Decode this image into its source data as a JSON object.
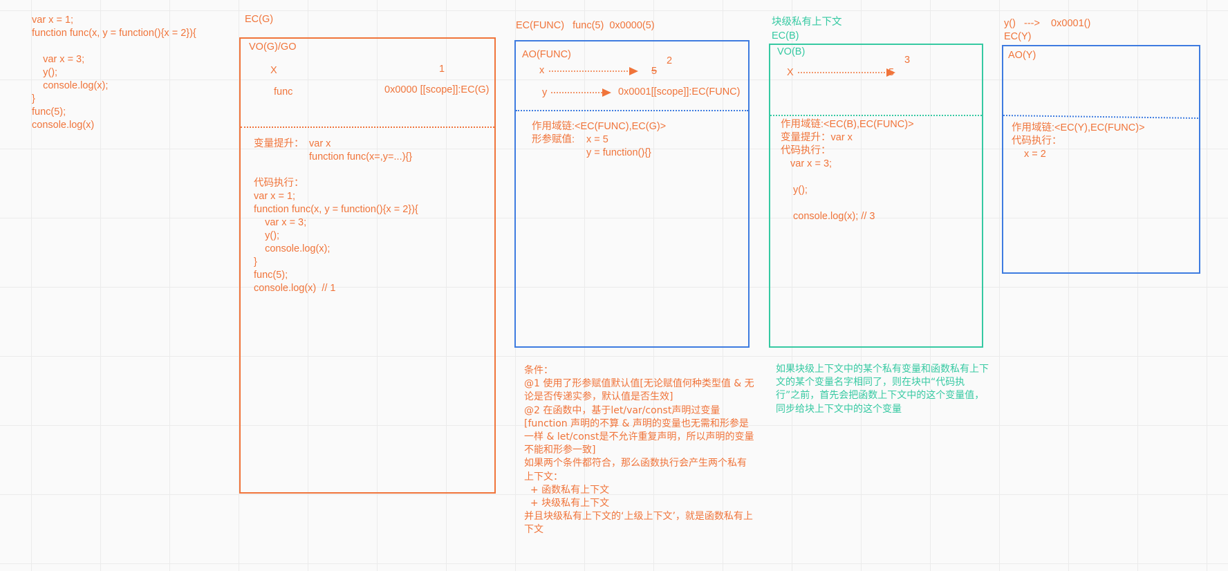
{
  "colors": {
    "orange": "#f0743a",
    "blue": "#3d7be0",
    "teal": "#36c9a2",
    "grid": "#ebebeb",
    "background": "#fafafa"
  },
  "source_code": [
    "var x = 1;",
    "function func(x, y = function(){x = 2}){",
    "",
    "    var x = 3;",
    "    y();",
    "    console.log(x);",
    "}",
    "func(5);",
    "console.log(x)"
  ],
  "ecg": {
    "title": "EC(G)",
    "vo_label": "VO(G)/GO",
    "var_x": "X",
    "val_x": "1",
    "var_func": "func",
    "val_func": "0x0000 [[scope]]:EC(G)",
    "hoist_label": "变量提升：",
    "hoist_lines": [
      "var x",
      "function func(x=,y=...){}"
    ],
    "exec_label": "代码执行：",
    "exec_lines": [
      "var x = 1;",
      "function func(x, y = function(){x = 2}){",
      "    var x = 3;",
      "    y();",
      "    console.log(x);",
      "}",
      "func(5);",
      "console.log(x)  // 1"
    ]
  },
  "ecfunc": {
    "title": "EC(FUNC)   func(5)  0x0000(5)",
    "ao_label": "AO(FUNC)",
    "var_x": "x",
    "val_x_old": "5",
    "val_x_new": "2",
    "var_y": "y",
    "val_y": "0x0001[[scope]]:EC(FUNC)",
    "scope_chain": "作用域链:<EC(FUNC),EC(G)>",
    "param_label": "形参赋值:",
    "param_lines": [
      "x = 5",
      "y = function(){}"
    ]
  },
  "conditions": [
    "条件：",
    "@1 使用了形参赋值默认值[无论赋值何种类型值 & 无论是否传递实参，默认值是否生效]",
    "@2 在函数中，基于let/var/const声明过变量[function 声明的不算 & 声明的变量也无需和形参是一样 & let/const是不允许重复声明，所以声明的变量不能和形参一致]",
    "如果两个条件都符合，那么函数执行会产生两个私有上下文：",
    "  + 函数私有上下文",
    "  + 块级私有上下文",
    "并且块级私有上下文的‘上级上下文’，就是函数私有上下文"
  ],
  "ecb": {
    "heading": "块级私有上下文",
    "title": "EC(B)",
    "vo_label": "VO(B)",
    "var_x": "X",
    "val_x_old": "5",
    "val_x_new": "3",
    "scope_chain": "作用域链:<EC(B),EC(FUNC)>",
    "hoist": "变量提升：var x",
    "exec_label": "代码执行：",
    "exec_lines": [
      "var x = 3;",
      "y();",
      "console.log(x);  // 3"
    ],
    "note": "如果块级上下文中的某个私有变量和函数私有上下文的某个变量名字相同了，则在块中“代码执行”之前，首先会把函数上下文中的这个变量值，同步给块上下文中的这个变量"
  },
  "ecy": {
    "call": "y()   --->    0x0001()",
    "title": "EC(Y)",
    "ao_label": "AO(Y)",
    "scope_chain": "作用域链:<EC(Y),EC(FUNC)>",
    "exec_label": "代码执行：",
    "exec_line": "x = 2"
  }
}
